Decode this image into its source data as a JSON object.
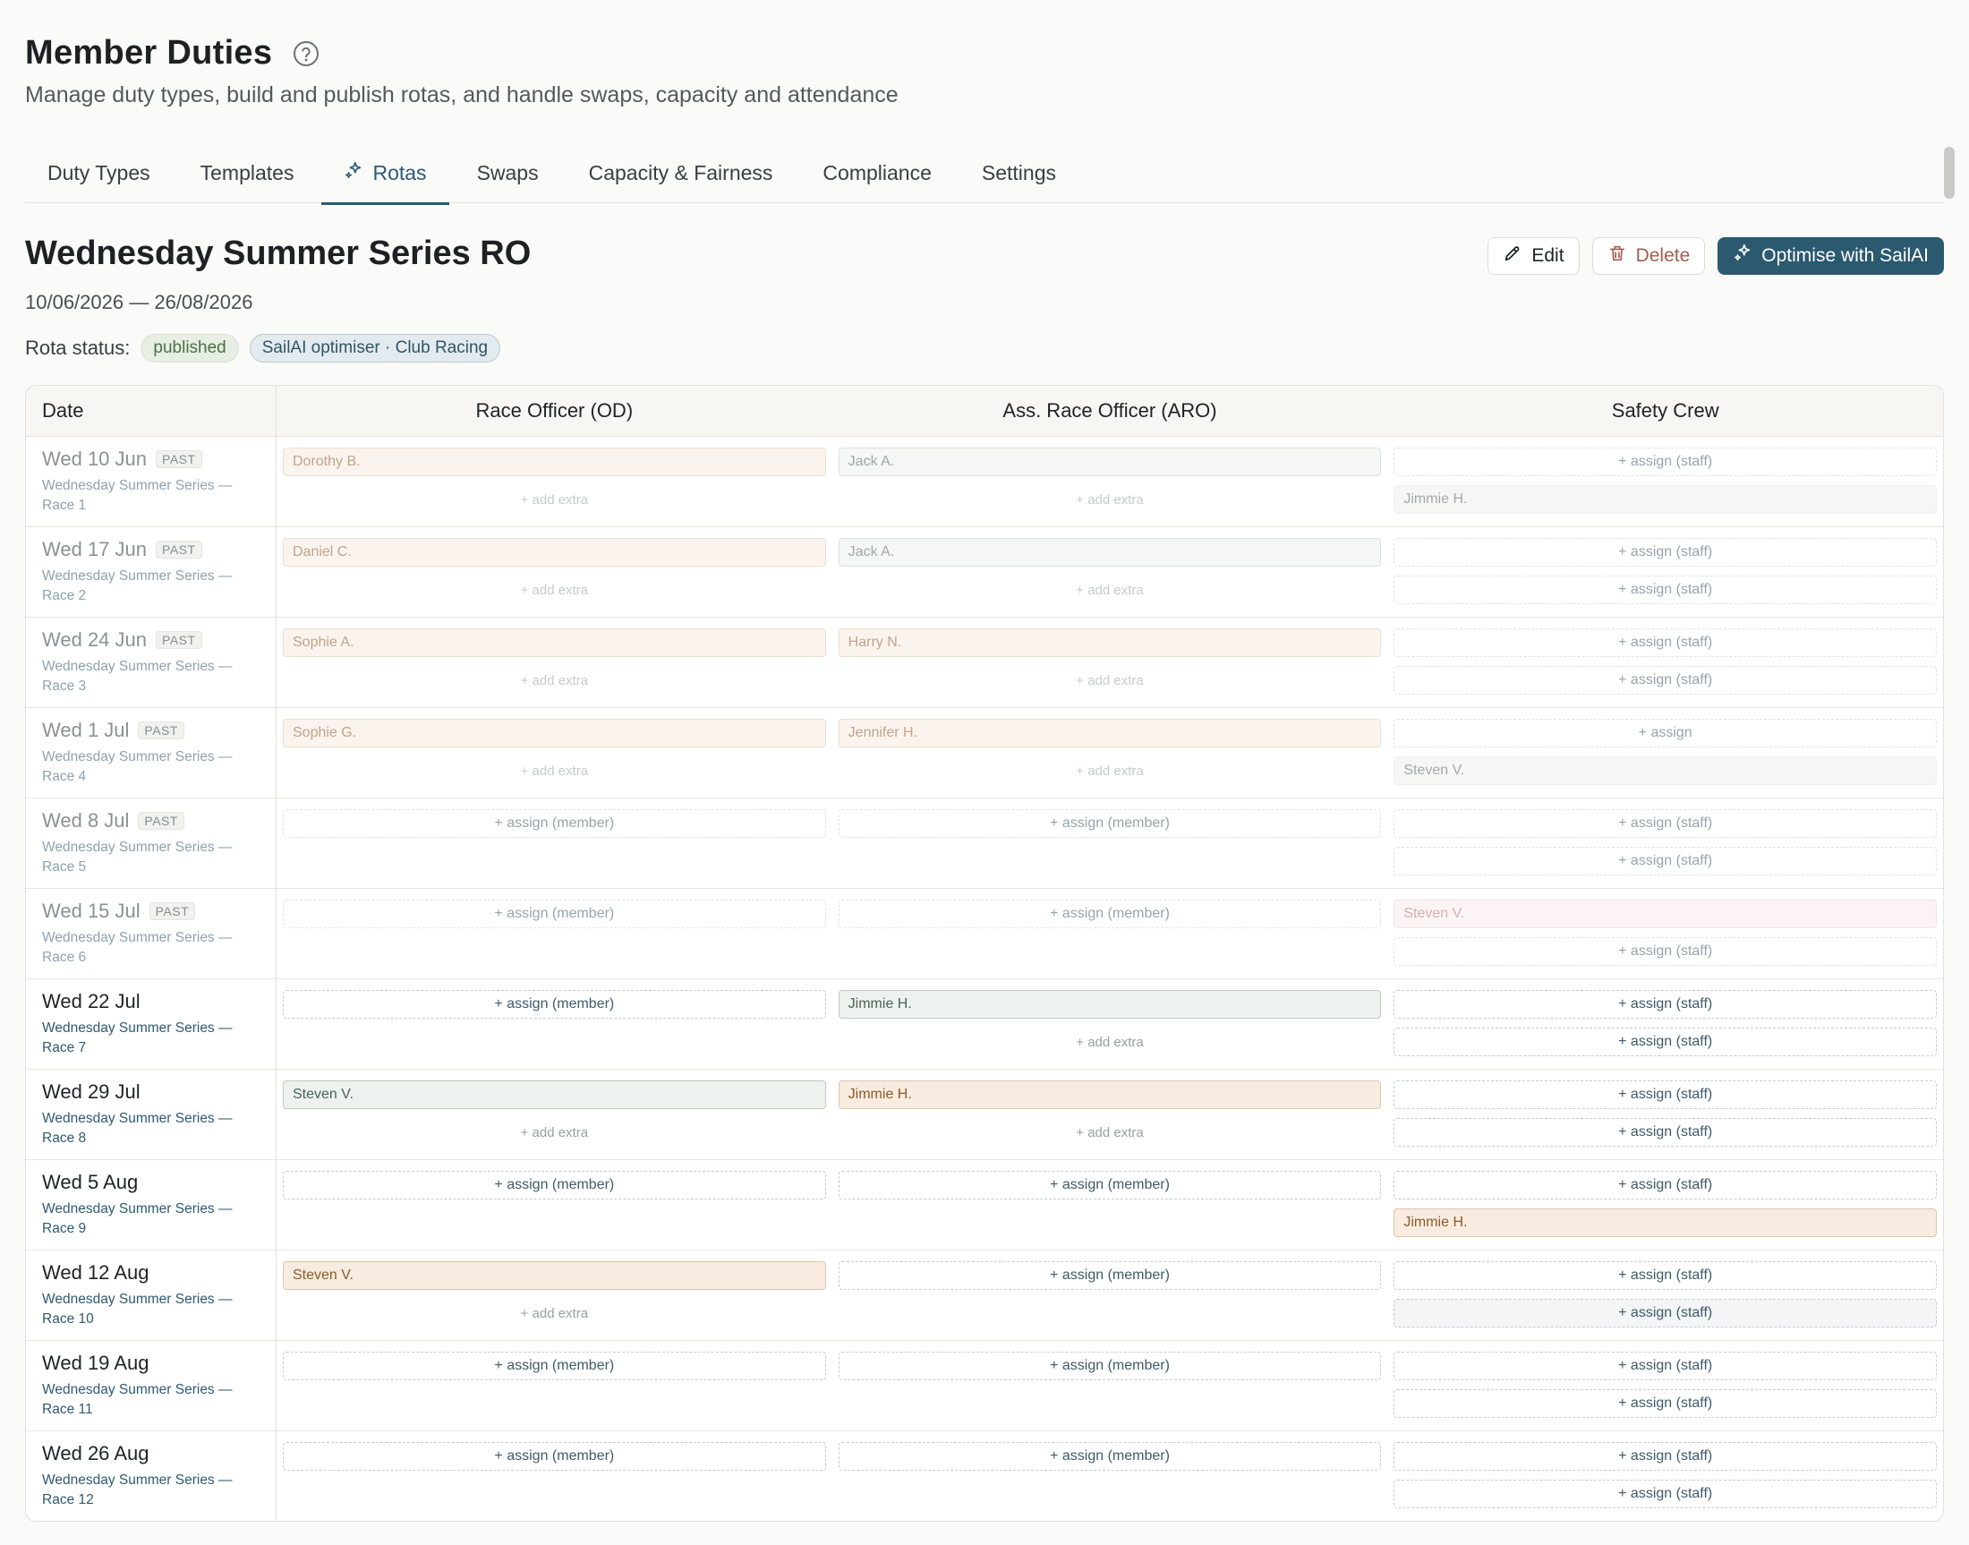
{
  "header": {
    "title": "Member Duties",
    "subtitle": "Manage duty types, build and publish rotas, and handle swaps, capacity and attendance"
  },
  "tabs": [
    {
      "label": "Duty Types"
    },
    {
      "label": "Templates"
    },
    {
      "label": "Rotas",
      "active": true,
      "icon": "sparkle-icon"
    },
    {
      "label": "Swaps"
    },
    {
      "label": "Capacity & Fairness"
    },
    {
      "label": "Compliance"
    },
    {
      "label": "Settings"
    }
  ],
  "rota": {
    "title": "Wednesday Summer Series RO",
    "dates": "10/06/2026 — 26/08/2026",
    "status_label": "Rota status:",
    "status_badge": "published",
    "optimiser_badge": "SailAI optimiser · Club Racing"
  },
  "actions": {
    "edit": "Edit",
    "delete": "Delete",
    "optimise": "Optimise with SailAI"
  },
  "colors": {
    "accent": "#2b5970",
    "member_green": "#eef2ef",
    "member_orange": "#f8ebdf",
    "conflict_red": "#fbecec"
  },
  "table": {
    "headers": {
      "date": "Date",
      "od": "Race Officer (OD)",
      "aro": "Ass. Race Officer (ARO)",
      "safety": "Safety Crew"
    },
    "past_tag": "PAST",
    "rows": [
      {
        "date": "Wed 10 Jun",
        "past": true,
        "event1": "Wednesday Summer Series —",
        "event2": "Race 1",
        "od": [
          {
            "t": "name",
            "text": "Dorothy B.",
            "c": "orange"
          },
          {
            "t": "extra",
            "text": "+ add extra"
          }
        ],
        "aro": [
          {
            "t": "name",
            "text": "Jack A.",
            "c": "green"
          },
          {
            "t": "extra",
            "text": "+ add extra"
          }
        ],
        "safety": [
          {
            "t": "assign",
            "text": "+ assign (staff)"
          },
          {
            "t": "name",
            "text": "Jimmie H.",
            "c": "grey"
          }
        ]
      },
      {
        "date": "Wed 17 Jun",
        "past": true,
        "event1": "Wednesday Summer Series —",
        "event2": "Race 2",
        "od": [
          {
            "t": "name",
            "text": "Daniel C.",
            "c": "orange"
          },
          {
            "t": "extra",
            "text": "+ add extra"
          }
        ],
        "aro": [
          {
            "t": "name",
            "text": "Jack A.",
            "c": "green"
          },
          {
            "t": "extra",
            "text": "+ add extra"
          }
        ],
        "safety": [
          {
            "t": "assign",
            "text": "+ assign (staff)"
          },
          {
            "t": "assign",
            "text": "+ assign (staff)"
          }
        ]
      },
      {
        "date": "Wed 24 Jun",
        "past": true,
        "event1": "Wednesday Summer Series —",
        "event2": "Race 3",
        "od": [
          {
            "t": "name",
            "text": "Sophie A.",
            "c": "orange"
          },
          {
            "t": "extra",
            "text": "+ add extra"
          }
        ],
        "aro": [
          {
            "t": "name",
            "text": "Harry N.",
            "c": "orange"
          },
          {
            "t": "extra",
            "text": "+ add extra"
          }
        ],
        "safety": [
          {
            "t": "assign",
            "text": "+ assign (staff)"
          },
          {
            "t": "assign",
            "text": "+ assign (staff)"
          }
        ]
      },
      {
        "date": "Wed 1 Jul",
        "past": true,
        "event1": "Wednesday Summer Series —",
        "event2": "Race 4",
        "od": [
          {
            "t": "name",
            "text": "Sophie G.",
            "c": "orange"
          },
          {
            "t": "extra",
            "text": "+ add extra"
          }
        ],
        "aro": [
          {
            "t": "name",
            "text": "Jennifer H.",
            "c": "orange"
          },
          {
            "t": "extra",
            "text": "+ add extra"
          }
        ],
        "safety": [
          {
            "t": "assign",
            "text": "+ assign"
          },
          {
            "t": "name",
            "text": "Steven V.",
            "c": "grey"
          }
        ]
      },
      {
        "date": "Wed 8 Jul",
        "past": true,
        "event1": "Wednesday Summer Series —",
        "event2": "Race 5",
        "od": [
          {
            "t": "assign",
            "text": "+ assign (member)"
          }
        ],
        "aro": [
          {
            "t": "assign",
            "text": "+ assign (member)"
          }
        ],
        "safety": [
          {
            "t": "assign",
            "text": "+ assign (staff)"
          },
          {
            "t": "assign",
            "text": "+ assign (staff)"
          }
        ]
      },
      {
        "date": "Wed 15 Jul",
        "past": true,
        "event1": "Wednesday Summer Series —",
        "event2": "Race 6",
        "od": [
          {
            "t": "assign",
            "text": "+ assign (member)"
          }
        ],
        "aro": [
          {
            "t": "assign",
            "text": "+ assign (member)"
          }
        ],
        "safety": [
          {
            "t": "name",
            "text": "Steven V.",
            "c": "red"
          },
          {
            "t": "assign",
            "text": "+ assign (staff)"
          }
        ]
      },
      {
        "date": "Wed 22 Jul",
        "past": false,
        "event1": "Wednesday Summer Series —",
        "event2": "Race 7",
        "od": [
          {
            "t": "assign",
            "text": "+ assign (member)"
          }
        ],
        "aro": [
          {
            "t": "name",
            "text": "Jimmie H.",
            "c": "green"
          },
          {
            "t": "extra",
            "text": "+ add extra"
          }
        ],
        "safety": [
          {
            "t": "assign",
            "text": "+ assign (staff)"
          },
          {
            "t": "assign",
            "text": "+ assign (staff)"
          }
        ]
      },
      {
        "date": "Wed 29 Jul",
        "past": false,
        "event1": "Wednesday Summer Series —",
        "event2": "Race 8",
        "od": [
          {
            "t": "name",
            "text": "Steven V.",
            "c": "green"
          },
          {
            "t": "extra",
            "text": "+ add extra"
          }
        ],
        "aro": [
          {
            "t": "name",
            "text": "Jimmie H.",
            "c": "orange"
          },
          {
            "t": "extra",
            "text": "+ add extra"
          }
        ],
        "safety": [
          {
            "t": "assign",
            "text": "+ assign (staff)"
          },
          {
            "t": "assign",
            "text": "+ assign (staff)"
          }
        ]
      },
      {
        "date": "Wed 5 Aug",
        "past": false,
        "event1": "Wednesday Summer Series —",
        "event2": "Race 9",
        "od": [
          {
            "t": "assign",
            "text": "+ assign (member)"
          }
        ],
        "aro": [
          {
            "t": "assign",
            "text": "+ assign (member)"
          }
        ],
        "safety": [
          {
            "t": "assign",
            "text": "+ assign (staff)"
          },
          {
            "t": "name",
            "text": "Jimmie H.",
            "c": "orange"
          }
        ]
      },
      {
        "date": "Wed 12 Aug",
        "past": false,
        "event1": "Wednesday Summer Series —",
        "event2": "Race 10",
        "od": [
          {
            "t": "name",
            "text": "Steven V.",
            "c": "orange"
          },
          {
            "t": "extra",
            "text": "+ add extra"
          }
        ],
        "aro": [
          {
            "t": "assign",
            "text": "+ assign (member)"
          }
        ],
        "safety": [
          {
            "t": "assign",
            "text": "+ assign (staff)"
          },
          {
            "t": "assign",
            "text": "+ assign (staff)",
            "shaded": true
          }
        ]
      },
      {
        "date": "Wed 19 Aug",
        "past": false,
        "event1": "Wednesday Summer Series —",
        "event2": "Race 11",
        "od": [
          {
            "t": "assign",
            "text": "+ assign (member)"
          }
        ],
        "aro": [
          {
            "t": "assign",
            "text": "+ assign (member)"
          }
        ],
        "safety": [
          {
            "t": "assign",
            "text": "+ assign (staff)"
          },
          {
            "t": "assign",
            "text": "+ assign (staff)"
          }
        ]
      },
      {
        "date": "Wed 26 Aug",
        "past": false,
        "event1": "Wednesday Summer Series —",
        "event2": "Race 12",
        "od": [
          {
            "t": "assign",
            "text": "+ assign (member)"
          }
        ],
        "aro": [
          {
            "t": "assign",
            "text": "+ assign (member)"
          }
        ],
        "safety": [
          {
            "t": "assign",
            "text": "+ assign (staff)"
          },
          {
            "t": "assign",
            "text": "+ assign (staff)"
          }
        ]
      }
    ]
  }
}
